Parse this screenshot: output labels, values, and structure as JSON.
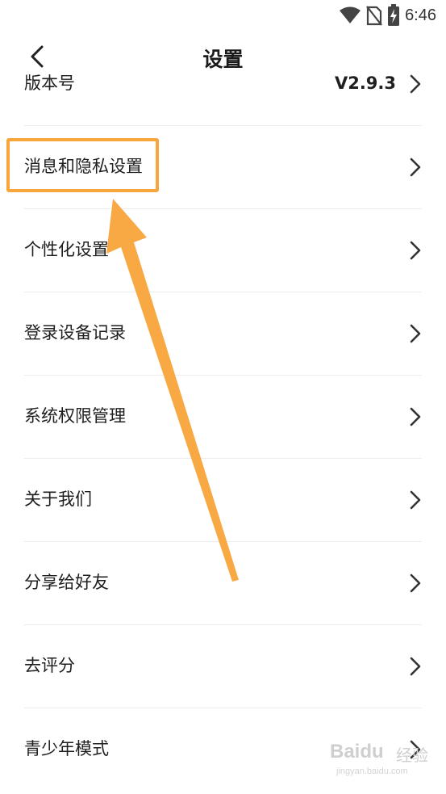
{
  "status_bar": {
    "time": "6:46",
    "icons": [
      "wifi-icon",
      "no-sim-icon",
      "battery-charging-icon"
    ]
  },
  "header": {
    "title": "设置",
    "back_icon": "chevron-left-icon"
  },
  "settings": {
    "items": [
      {
        "label": "版本号",
        "value": "V2.9.3"
      },
      {
        "label": "消息和隐私设置"
      },
      {
        "label": "个性化设置"
      },
      {
        "label": "登录设备记录"
      },
      {
        "label": "系统权限管理"
      },
      {
        "label": "关于我们"
      },
      {
        "label": "分享给好友"
      },
      {
        "label": "去评分"
      },
      {
        "label": "青少年模式"
      }
    ],
    "row_icon": "chevron-right-icon"
  },
  "annotation": {
    "highlight_color": "#f8a53c",
    "arrow_color": "#f8a53c"
  },
  "watermark": {
    "logo": "Baidu",
    "jingyan": "经验",
    "url": "jingyan.baidu.com"
  }
}
